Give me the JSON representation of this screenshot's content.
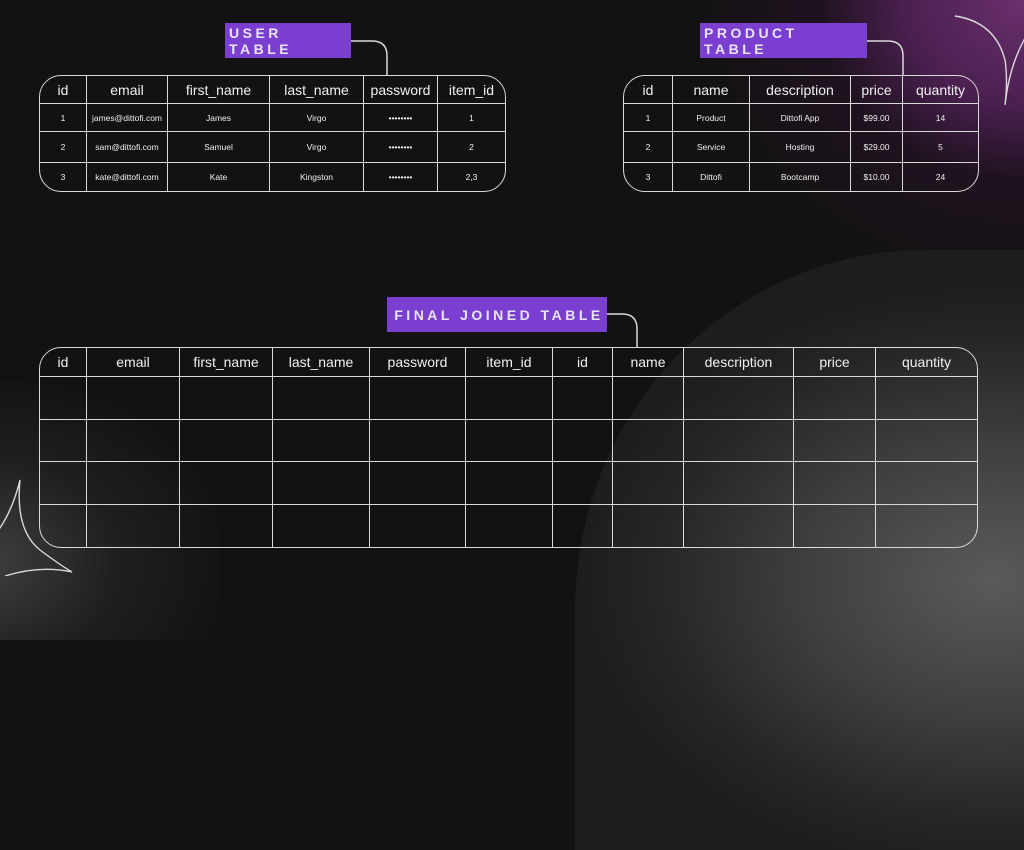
{
  "colors": {
    "tag_background": "#7a3fd1",
    "line": "#d9d9d9",
    "background": "#121212",
    "accent_glow": "#6b2f6e"
  },
  "user_table": {
    "label": "USER TABLE",
    "columns": [
      "id",
      "email",
      "first_name",
      "last_name",
      "password",
      "item_id"
    ],
    "rows": [
      [
        "1",
        "james@dittofi.com",
        "James",
        "Virgo",
        "••••••••",
        "1"
      ],
      [
        "2",
        "sam@dittofi.com",
        "Samuel",
        "Virgo",
        "••••••••",
        "2"
      ],
      [
        "3",
        "kate@dittofi.com",
        "Kate",
        "Kingston",
        "••••••••",
        "2,3"
      ]
    ]
  },
  "product_table": {
    "label": "PRODUCT TABLE",
    "columns": [
      "id",
      "name",
      "description",
      "price",
      "quantity"
    ],
    "rows": [
      [
        "1",
        "Product",
        "Dittofi App",
        "$99.00",
        "14"
      ],
      [
        "2",
        "Service",
        "Hosting",
        "$29.00",
        "5"
      ],
      [
        "3",
        "Dittofi",
        "Bootcamp",
        "$10.00",
        "24"
      ]
    ]
  },
  "joined_table": {
    "label": "FINAL JOINED TABLE",
    "columns": [
      "id",
      "email",
      "first_name",
      "last_name",
      "password",
      "item_id",
      "id",
      "name",
      "description",
      "price",
      "quantity"
    ],
    "rows": [
      [
        "",
        "",
        "",
        "",
        "",
        "",
        "",
        "",
        "",
        "",
        ""
      ],
      [
        "",
        "",
        "",
        "",
        "",
        "",
        "",
        "",
        "",
        "",
        ""
      ],
      [
        "",
        "",
        "",
        "",
        "",
        "",
        "",
        "",
        "",
        "",
        ""
      ],
      [
        "",
        "",
        "",
        "",
        "",
        "",
        "",
        "",
        "",
        "",
        ""
      ]
    ]
  },
  "decorations": [
    "sparkle-star-icon",
    "sparkle-star-icon"
  ]
}
